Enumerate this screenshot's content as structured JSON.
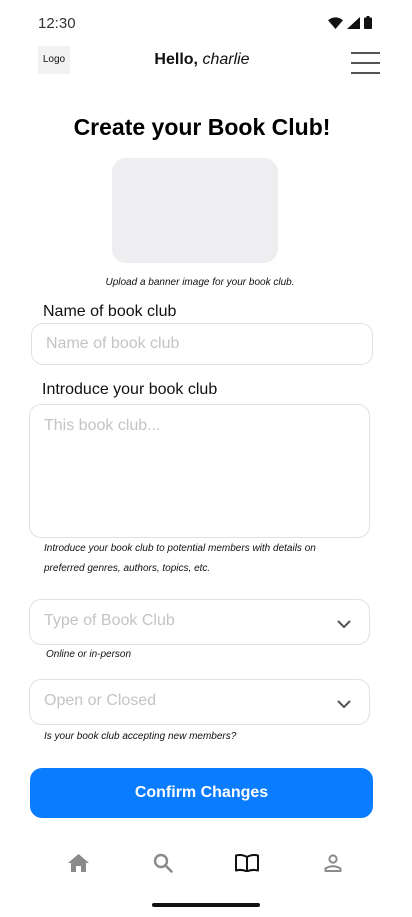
{
  "status_bar": {
    "time": "12:30",
    "icons": [
      "wifi-icon",
      "signal-icon",
      "battery-icon"
    ]
  },
  "header": {
    "logo": "Logo",
    "greeting_hello": "Hello,",
    "greeting_name": "charlie",
    "menu_icon": "hamburger-menu-icon"
  },
  "form": {
    "title": "Create your Book Club!",
    "banner_help": "Upload a banner image for your book club.",
    "name_label": "Name of book club",
    "name_placeholder": "Name of book club",
    "name_value": "",
    "intro_label": "Introduce your book club",
    "intro_placeholder": "This book club...",
    "intro_value": "",
    "intro_help_line1": "Introduce your book club to potential members with details on",
    "intro_help_line2": "preferred genres, authors, topics, etc.",
    "type_placeholder": "Type of Book Club",
    "type_help": "Online or in-person",
    "open_placeholder": "Open or Closed",
    "open_help": "Is your book club accepting new members?",
    "confirm_label": "Confirm Changes"
  },
  "bottom_nav": {
    "items": [
      {
        "icon": "home-icon",
        "active": false
      },
      {
        "icon": "search-icon",
        "active": false
      },
      {
        "icon": "book-icon",
        "active": true
      },
      {
        "icon": "profile-icon",
        "active": false
      }
    ]
  },
  "colors": {
    "accent": "#0a7cff",
    "placeholder": "#c4c4c4",
    "border": "#e1e1e1",
    "banner": "#eeeef1",
    "nav_inactive": "#8a8a8a",
    "nav_active": "#111111"
  }
}
